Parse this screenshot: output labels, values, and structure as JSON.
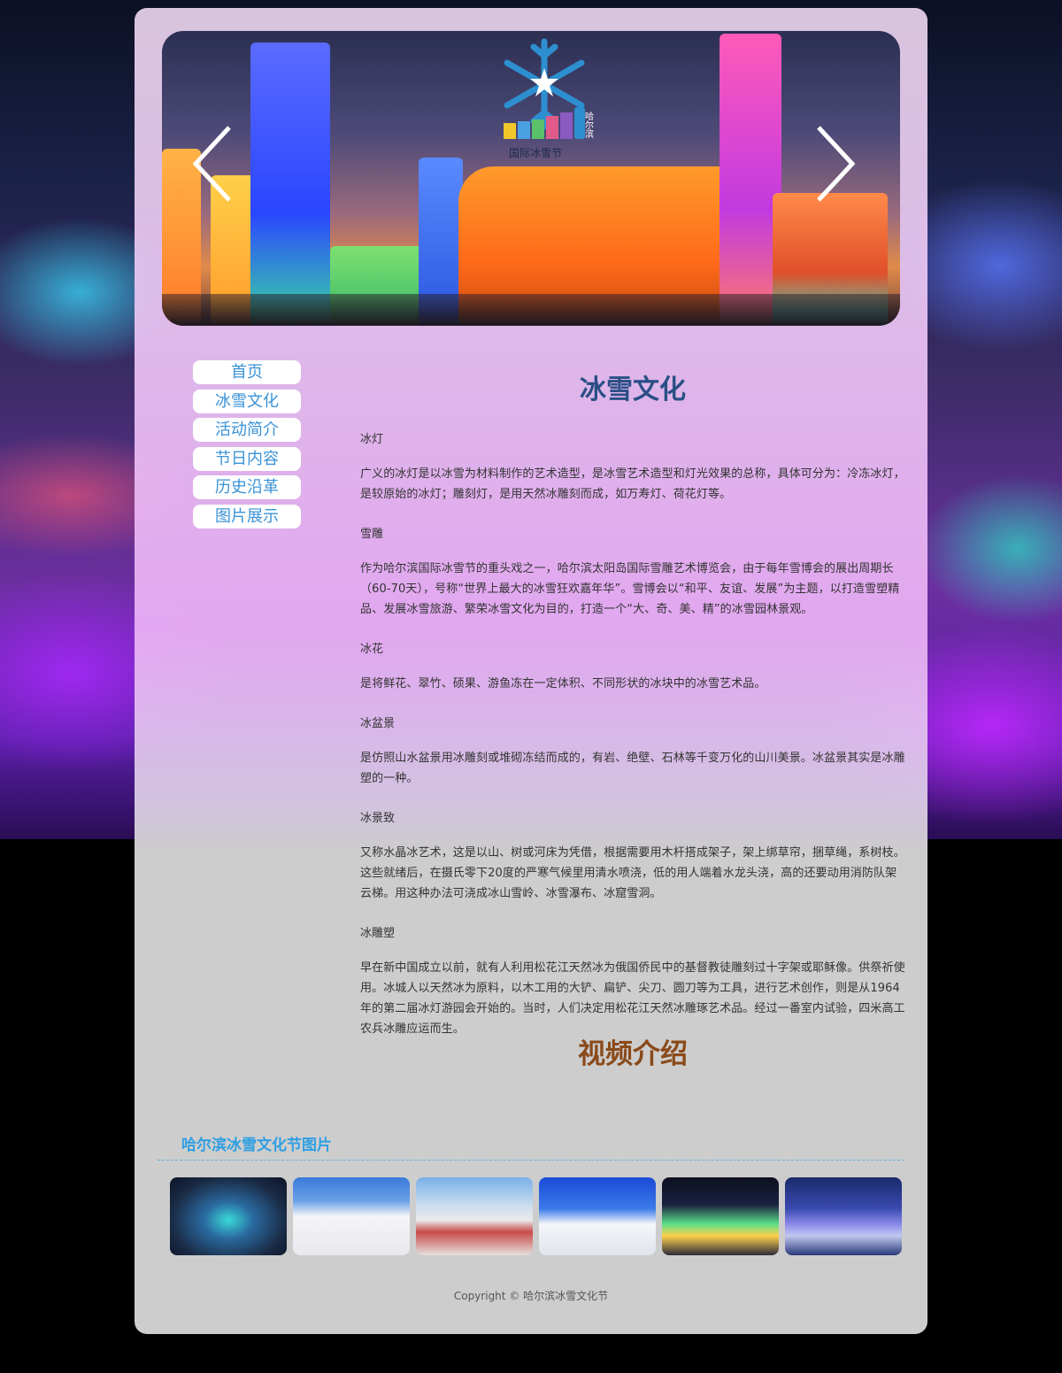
{
  "banner": {
    "logo_text": "国际冰雪节",
    "logo_city": "哈尔滨"
  },
  "nav": {
    "items": [
      {
        "label": "首页"
      },
      {
        "label": "冰雪文化"
      },
      {
        "label": "活动简介"
      },
      {
        "label": "节日内容"
      },
      {
        "label": "历史沿革"
      },
      {
        "label": "图片展示"
      }
    ]
  },
  "article": {
    "title": "冰雪文化",
    "sections": [
      {
        "heading": "冰灯",
        "body": "广义的冰灯是以冰雪为材料制作的艺术造型，是冰雪艺术造型和灯光效果的总称，具体可分为：冷冻冰灯，是较原始的冰灯；雕刻灯，是用天然冰雕刻而成，如万寿灯、荷花灯等。"
      },
      {
        "heading": "雪雕",
        "body": "作为哈尔滨国际冰雪节的重头戏之一，哈尔滨太阳岛国际雪雕艺术博览会，由于每年雪博会的展出周期长（60-70天），号称“世界上最大的冰雪狂欢嘉年华”。雪博会以“和平、友谊、发展”为主题，以打造雪塑精品、发展冰雪旅游、繁荣冰雪文化为目的，打造一个“大、奇、美、精”的冰雪园林景观。"
      },
      {
        "heading": "冰花",
        "body": "是将鲜花、翠竹、硕果、游鱼冻在一定体积、不同形状的冰块中的冰雪艺术品。"
      },
      {
        "heading": "冰盆景",
        "body": "是仿照山水盆景用冰雕刻或堆砌冻结而成的，有岩、绝壁、石林等千变万化的山川美景。冰盆景其实是冰雕塑的一种。"
      },
      {
        "heading": "冰景致",
        "body": "又称水晶冰艺术，这是以山、树或河床为凭借，根据需要用木杆搭成架子，架上绑草帘，捆草绳，系树枝。这些就绪后，在摄氏零下20度的严寒气候里用清水喷浇，低的用人端着水龙头浇，高的还要动用消防队架云梯。用这种办法可浇成冰山雪岭、冰雪瀑布、冰窟雪洞。"
      },
      {
        "heading": "冰雕塑",
        "body": "早在新中国成立以前，就有人利用松花江天然冰为俄国侨民中的基督教徒雕刻过十字架或耶稣像。供祭祈使用。冰城人以天然冰为原料，以木工用的大铲、扁铲、尖刀、圆刀等为工具，进行艺术创作，则是从1964年的第二届冰灯游园会开始的。当时，人们决定用松花江天然冰雕琢艺术品。经过一番室内试验，四米高工农兵冰雕应运而生。"
      }
    ],
    "video_title": "视频介绍"
  },
  "gallery": {
    "title": "哈尔滨冰雪文化节图片"
  },
  "footer": {
    "copyright": "Copyright © 哈尔滨冰雪文化节"
  },
  "colors": {
    "nav_text": "#3a93d8",
    "article_title": "#2a4f86",
    "video_title": "#8a4a1a",
    "gallery_title": "#2f9fe2"
  }
}
